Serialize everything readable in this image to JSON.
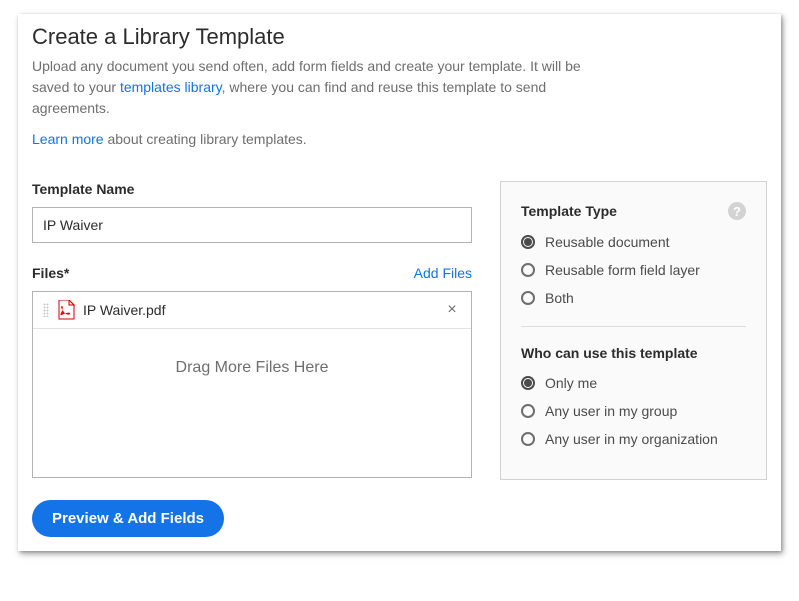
{
  "heading": "Create a Library Template",
  "description_pre": "Upload any document you send often, add form fields and create your template. It will be saved to your ",
  "description_link": "templates library",
  "description_post": ", where you can find and reuse this template to send agreements.",
  "learn_more_link": "Learn more",
  "learn_more_post": " about creating library templates.",
  "template_name_label": "Template Name",
  "template_name_value": "IP Waiver",
  "files_label": "Files*",
  "add_files": "Add Files",
  "file_item": "IP Waiver.pdf",
  "drag_text": "Drag More Files Here",
  "template_type_heading": "Template Type",
  "type_options": {
    "reusable_doc": "Reusable document",
    "reusable_form": "Reusable form field layer",
    "both": "Both"
  },
  "who_heading": "Who can use this template",
  "who_options": {
    "only_me": "Only me",
    "group": "Any user in my group",
    "org": "Any user in my organization"
  },
  "primary_button": "Preview & Add Fields"
}
